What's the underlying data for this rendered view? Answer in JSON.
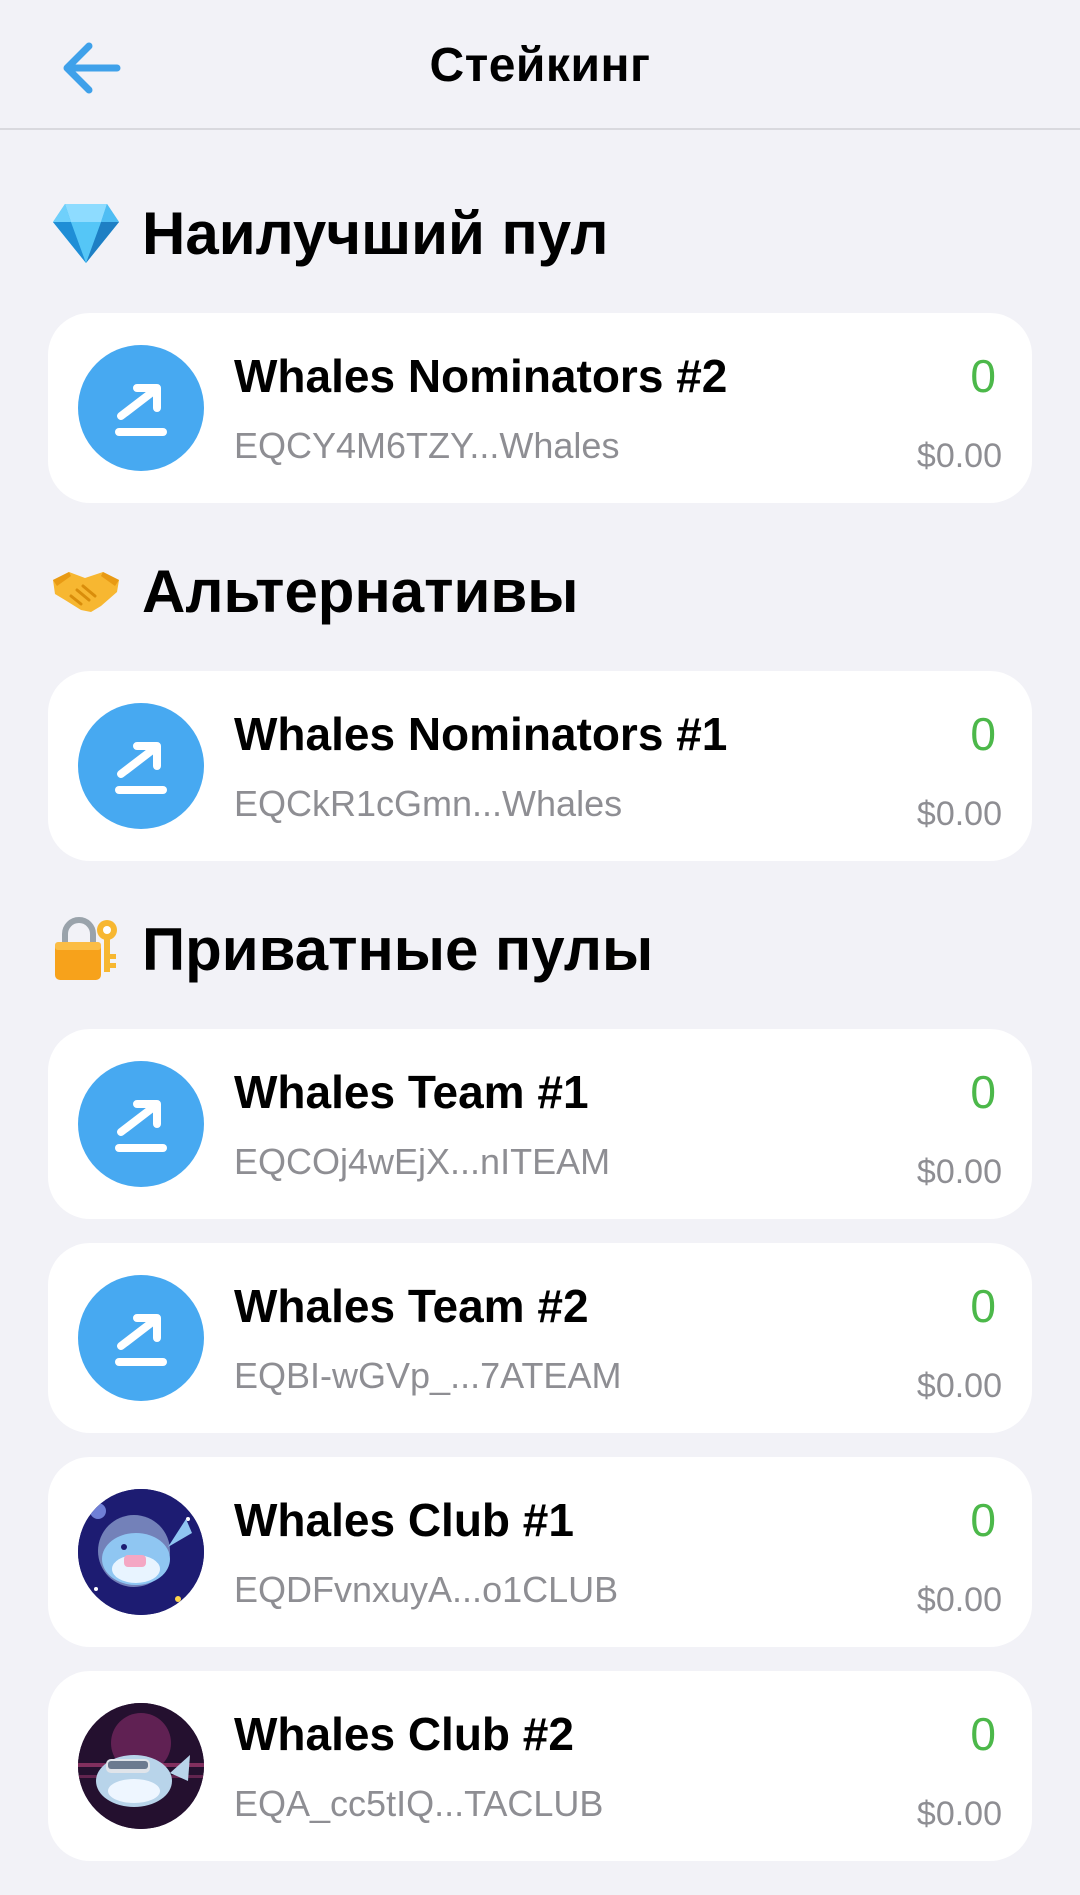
{
  "header": {
    "title": "Стейкинг",
    "back_icon": "arrow-left-icon",
    "accent_color": "#3fa1ea"
  },
  "sections": [
    {
      "title": "Наилучший пул",
      "emoji_icon": "gem-icon",
      "pools": [
        {
          "name": "Whales Nominators #2",
          "address": "EQCY4M6TZY...Whales",
          "balance": "0",
          "usd": "$0.00",
          "avatar": "staking-arrow-icon"
        }
      ]
    },
    {
      "title": "Альтернативы",
      "emoji_icon": "handshake-icon",
      "pools": [
        {
          "name": "Whales Nominators #1",
          "address": "EQCkR1cGmn...Whales",
          "balance": "0",
          "usd": "$0.00",
          "avatar": "staking-arrow-icon"
        }
      ]
    },
    {
      "title": "Приватные пулы",
      "emoji_icon": "lock-with-key-icon",
      "pools": [
        {
          "name": "Whales Team #1",
          "address": "EQCOj4wEjX...nITEAM",
          "balance": "0",
          "usd": "$0.00",
          "avatar": "staking-arrow-icon"
        },
        {
          "name": "Whales Team #2",
          "address": "EQBI-wGVp_...7ATEAM",
          "balance": "0",
          "usd": "$0.00",
          "avatar": "staking-arrow-icon"
        },
        {
          "name": "Whales Club #1",
          "address": "EQDFvnxuyA...o1CLUB",
          "balance": "0",
          "usd": "$0.00",
          "avatar": "astronaut-whale-image"
        },
        {
          "name": "Whales Club #2",
          "address": "EQA_cc5tIQ...TACLUB",
          "balance": "0",
          "usd": "$0.00",
          "avatar": "vr-whale-image"
        }
      ]
    }
  ],
  "colors": {
    "background": "#f2f2f7",
    "card": "#ffffff",
    "avatar_blue": "#47a9f1",
    "balance_green": "#4cb84a",
    "secondary_text": "#8e8e93"
  }
}
